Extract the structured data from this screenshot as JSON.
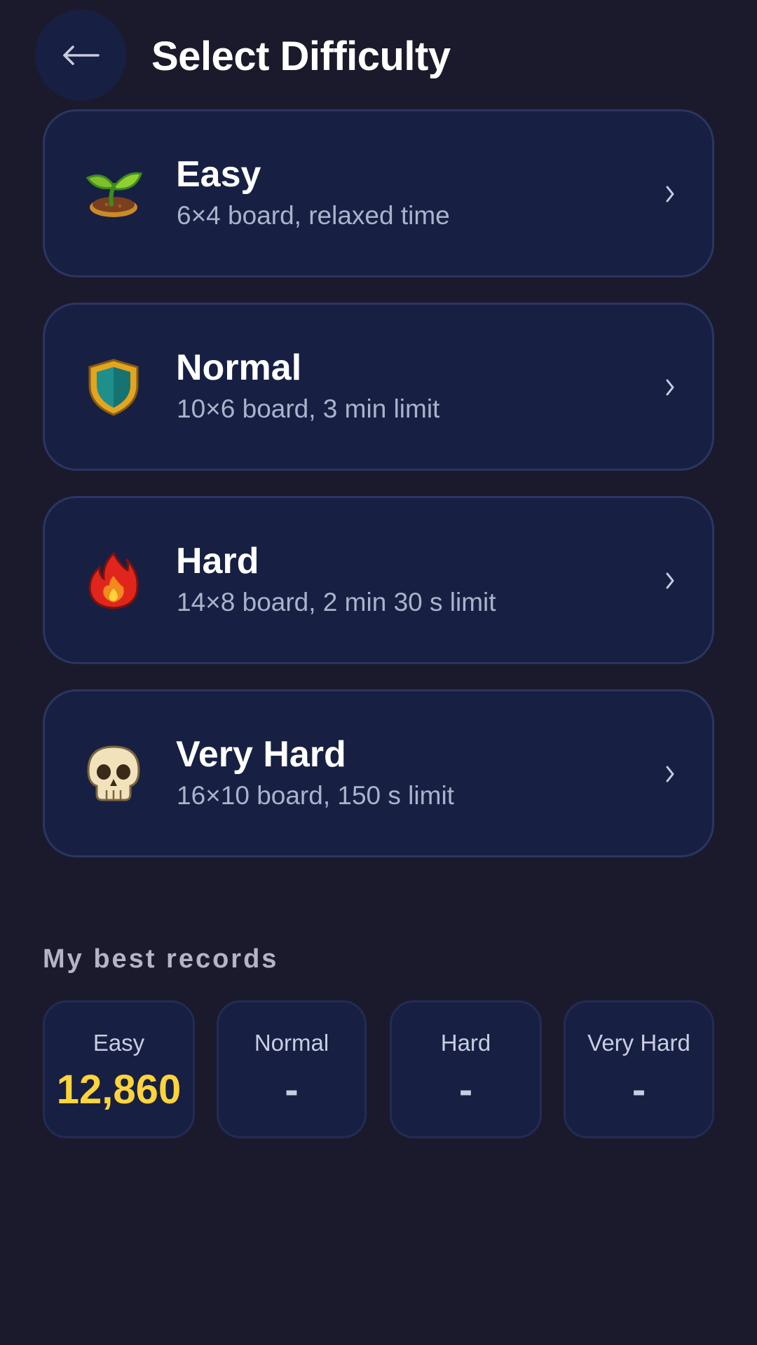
{
  "header": {
    "title": "Select Difficulty",
    "back_icon": "arrow-left-icon"
  },
  "difficulties": [
    {
      "title": "Easy",
      "description": "6×4 board, relaxed time",
      "icon": "seedling-icon"
    },
    {
      "title": "Normal",
      "description": "10×6 board, 3 min limit",
      "icon": "shield-icon"
    },
    {
      "title": "Hard",
      "description": "14×8 board, 2 min 30 s limit",
      "icon": "fire-icon"
    },
    {
      "title": "Very Hard",
      "description": "16×10 board, 150 s limit",
      "icon": "skull-icon"
    }
  ],
  "records": {
    "heading": "My best records",
    "items": [
      {
        "label": "Easy",
        "value": "12,860"
      },
      {
        "label": "Normal",
        "value": "-"
      },
      {
        "label": "Hard",
        "value": "-"
      },
      {
        "label": "Very Hard",
        "value": "-"
      }
    ]
  },
  "colors": {
    "background": "#1b1a2c",
    "card": "#172043",
    "highlight": "#ffd43b"
  }
}
